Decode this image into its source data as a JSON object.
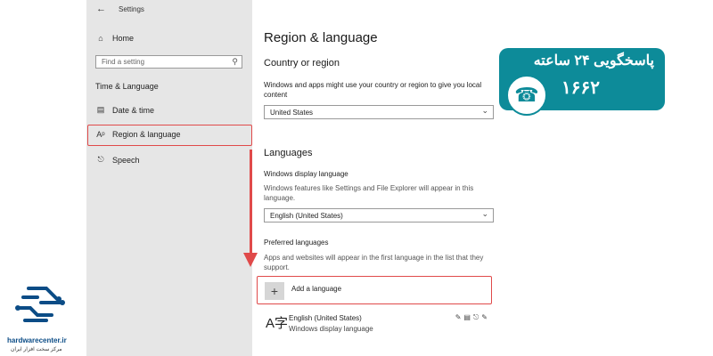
{
  "window": {
    "title": "Settings",
    "back_icon": "back-arrow-icon"
  },
  "sidebar": {
    "home_label": "Home",
    "search_placeholder": "Find a setting",
    "section_title": "Time & Language",
    "items": [
      {
        "label": "Date & time",
        "icon": "calendar-clock-icon"
      },
      {
        "label": "Region & language",
        "icon": "region-language-icon",
        "selected": true
      },
      {
        "label": "Speech",
        "icon": "microphone-icon"
      }
    ]
  },
  "main": {
    "page_title": "Region & language",
    "country": {
      "heading": "Country or region",
      "description": "Windows and apps might use your country or region to give you local content",
      "selected": "United States"
    },
    "languages": {
      "heading": "Languages",
      "display_label": "Windows display language",
      "display_description": "Windows features like Settings and File Explorer will appear in this language.",
      "display_selected": "English (United States)",
      "preferred_label": "Preferred languages",
      "preferred_description": "Apps and websites will appear in the first language in the list that they support.",
      "add_label": "Add a language",
      "add_symbol": "+",
      "list": [
        {
          "name": "English (United States)",
          "subtitle": "Windows display language",
          "glyph": "A字"
        }
      ]
    }
  },
  "badge": {
    "text_line1": "پاسخگویی ۲۴ ساعته",
    "text_line2": "۱۶۶۲",
    "phone_icon": "phone-clock-icon",
    "color": "#0d8b99"
  },
  "logo": {
    "domain": "hardwarecenter.ir",
    "tagline": "مرکز سخت افزار ایران",
    "color": "#0b4c86"
  },
  "highlight_color": "#e04a4a"
}
